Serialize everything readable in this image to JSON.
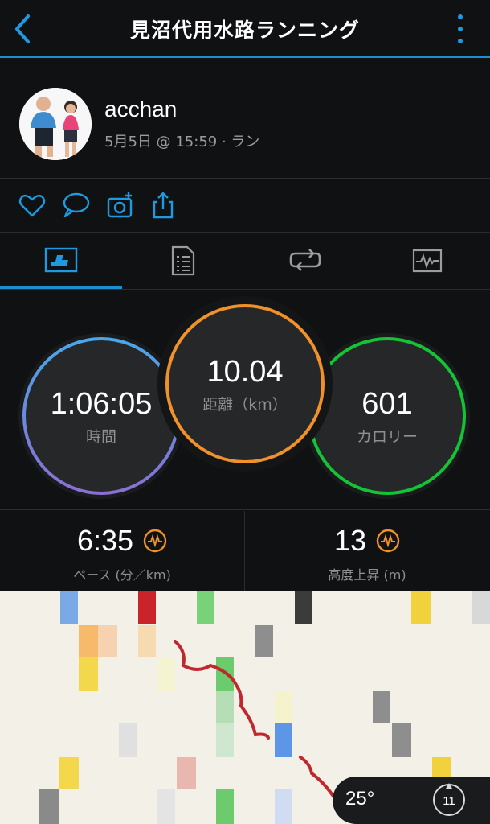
{
  "header": {
    "title": "見沼代用水路ランニング"
  },
  "activity": {
    "username": "acchan",
    "subtitle": "5月5日 @ 15:59 · ラン"
  },
  "actions": [
    {
      "icon": "heart-icon"
    },
    {
      "icon": "comment-icon"
    },
    {
      "icon": "add-photo-icon"
    },
    {
      "icon": "share-icon"
    }
  ],
  "tabs": [
    {
      "icon": "overview-icon",
      "selected": true
    },
    {
      "icon": "stats-list-icon",
      "selected": false
    },
    {
      "icon": "laps-icon",
      "selected": false
    },
    {
      "icon": "charts-icon",
      "selected": false
    }
  ],
  "stats": {
    "time": {
      "value": "1:06:05",
      "label": "時間"
    },
    "distance": {
      "value": "10.04",
      "label": "距離（km）"
    },
    "calories": {
      "value": "601",
      "label": "カロリー"
    }
  },
  "metrics": {
    "pace": {
      "value": "6:35",
      "label": "ペース (分／km)",
      "icon": "pulse-icon"
    },
    "elevation": {
      "value": "13",
      "label": "高度上昇 (m)",
      "icon": "pulse-icon"
    }
  },
  "weather": {
    "temperature": "25°",
    "wind": "11"
  },
  "colors": {
    "accent": "#1d8fd0",
    "time_ring": "#4aa0e6",
    "distance_ring": "#f0912a",
    "calories_ring": "#14c436",
    "metric_icon": "#f0912a",
    "route": "#c0282e"
  }
}
